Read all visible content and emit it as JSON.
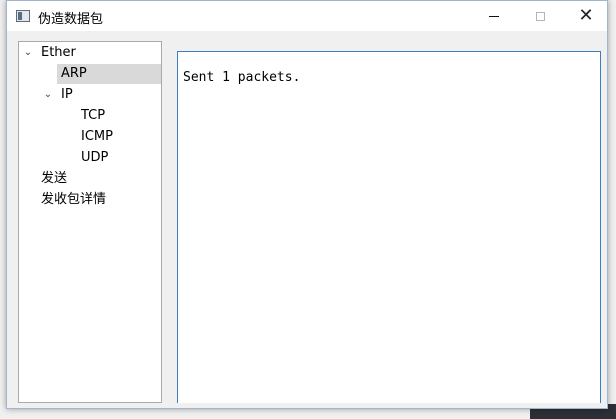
{
  "window": {
    "title": "伪造数据包",
    "controls": {
      "minimize_icon": "minimize-icon",
      "maximize_icon": "maximize-icon",
      "close_icon": "close-icon",
      "close_glyph": "✕"
    }
  },
  "tree": {
    "items": [
      {
        "label": "Ether",
        "expanded": true,
        "chevron": "⌄"
      },
      {
        "label": "ARP",
        "selected": true
      },
      {
        "label": "IP",
        "expanded": true,
        "chevron": "⌄"
      },
      {
        "label": "TCP"
      },
      {
        "label": "ICMP"
      },
      {
        "label": "UDP"
      },
      {
        "label": "发送"
      },
      {
        "label": "发收包详情"
      }
    ]
  },
  "output": {
    "text": "Sent 1 packets."
  },
  "colors": {
    "selection": "#d9d9d9",
    "focus_border": "#3b7fbf",
    "window_bg": "#f0f0f0"
  }
}
